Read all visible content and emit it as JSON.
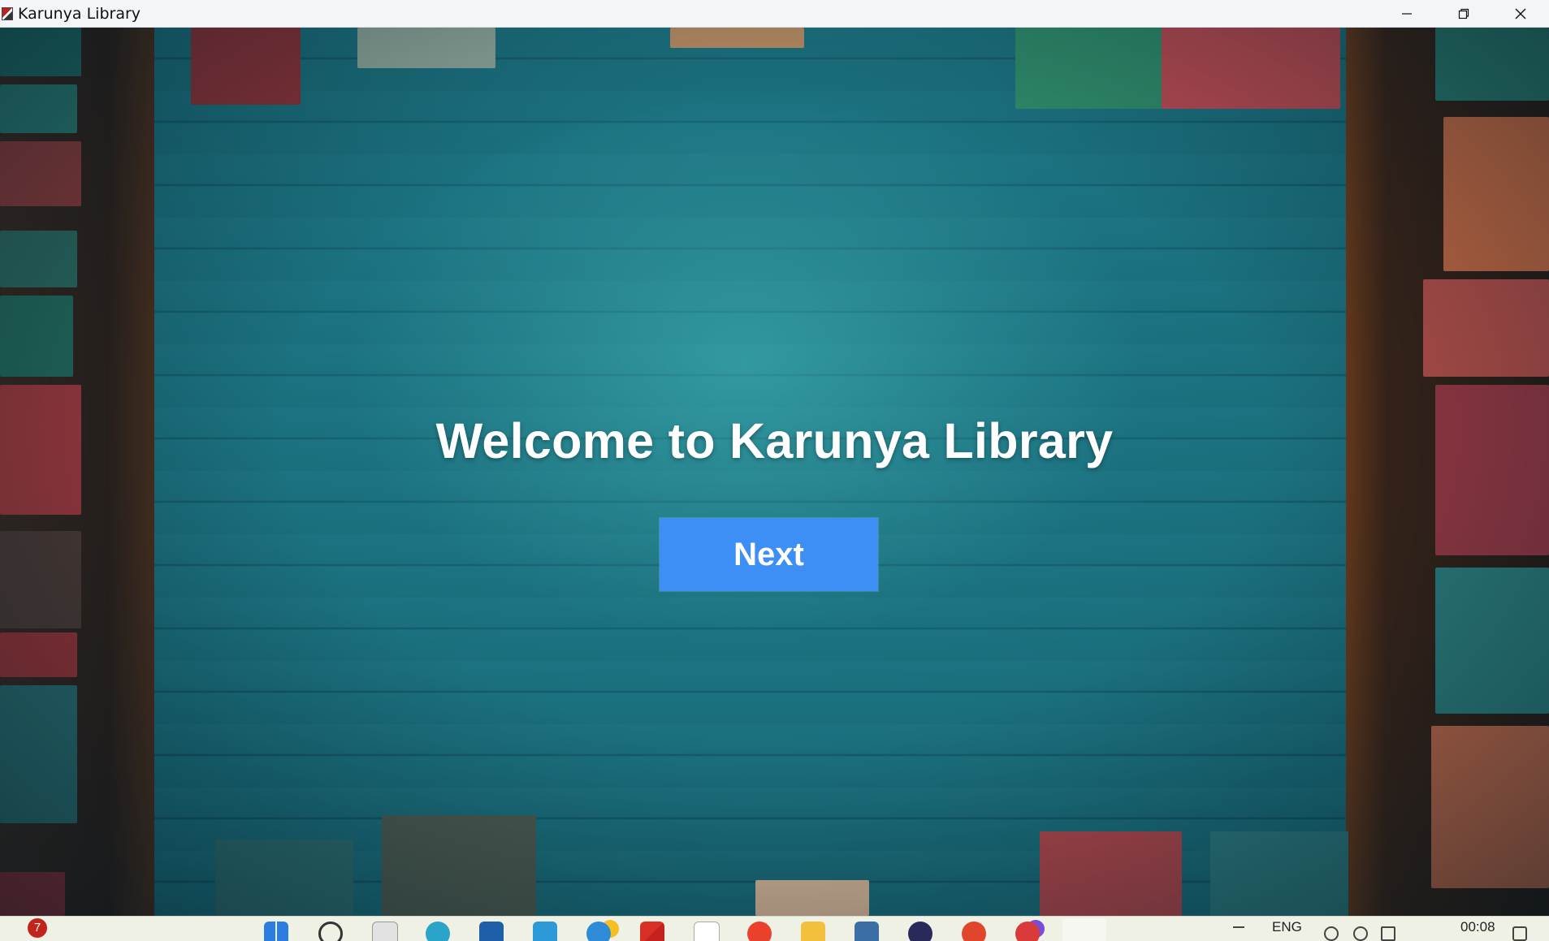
{
  "window": {
    "title": "Karunya Library",
    "controls": [
      "minimize-icon",
      "restore-icon",
      "close-icon"
    ]
  },
  "main": {
    "heading": "Welcome to Karunya Library",
    "next_label": "Next",
    "accent_color": "#3d8ef5"
  },
  "taskbar": {
    "notification_count": "7",
    "language": "ENG",
    "time": "00:08",
    "apps": [
      "start-icon",
      "search-icon",
      "file-icon",
      "edge-icon",
      "store-icon",
      "vscode-icon",
      "chrome-beta-icon",
      "gmail-icon",
      "app-icon",
      "chrome-icon",
      "folder-icon",
      "app2-icon",
      "app3-icon",
      "app4-icon",
      "app5-icon",
      "java-icon"
    ]
  }
}
